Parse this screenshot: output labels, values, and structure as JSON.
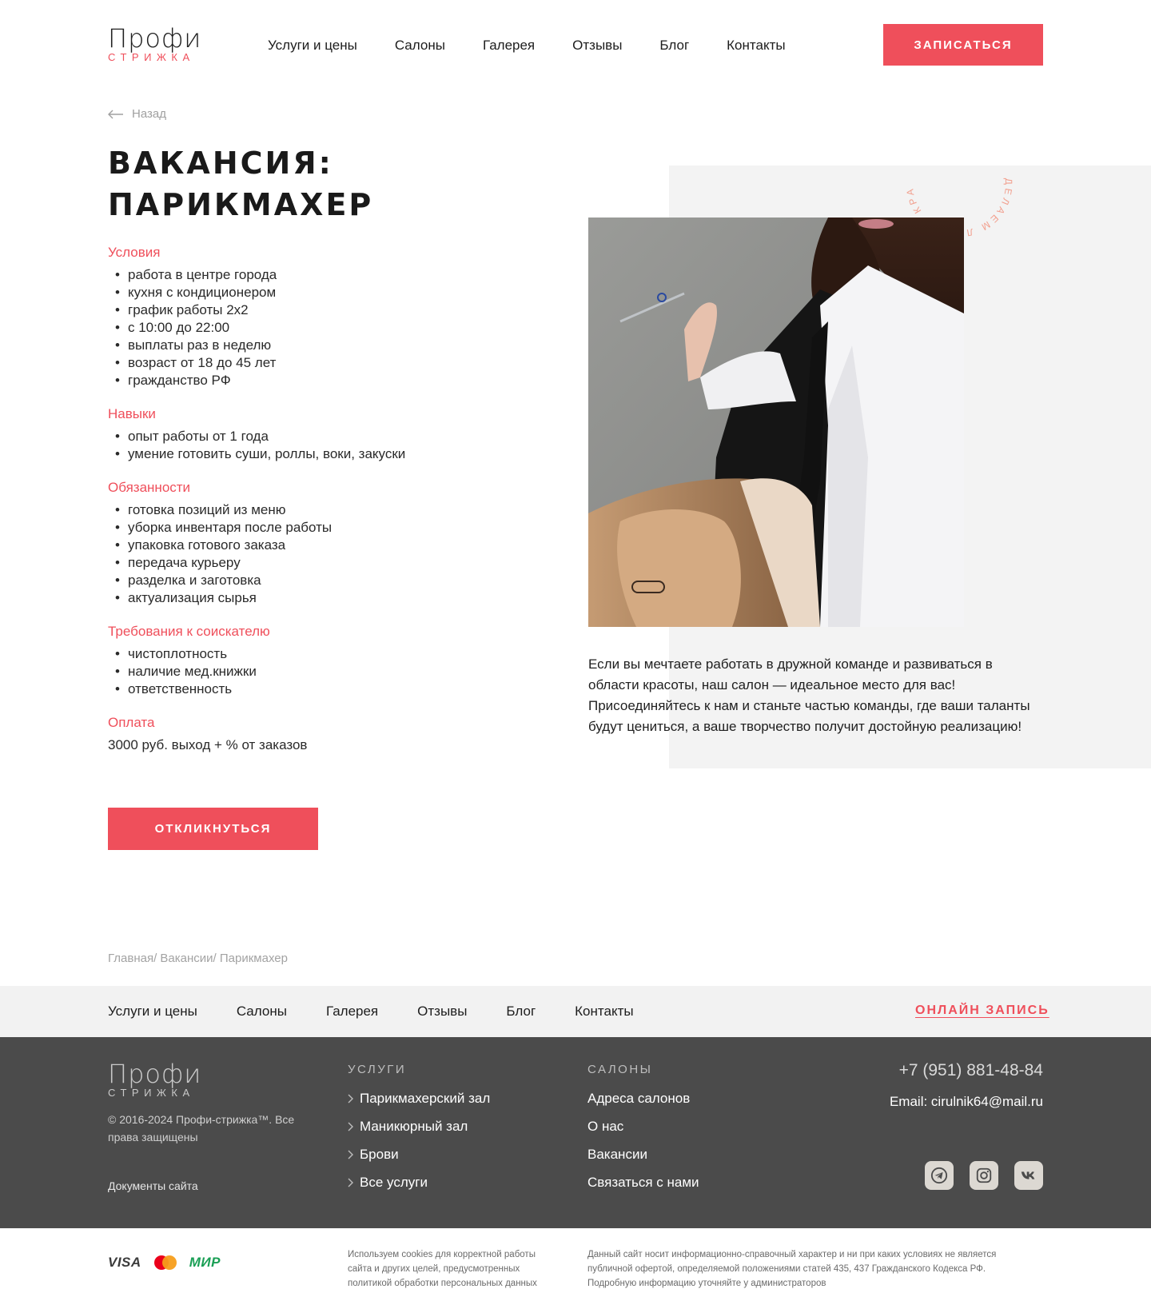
{
  "header": {
    "logo_top": "Профи",
    "logo_bottom": "стрижка",
    "nav": [
      "Услуги и цены",
      "Салоны",
      "Галерея",
      "Отзывы",
      "Блог",
      "Контакты"
    ],
    "signup_button": "Записаться"
  },
  "back_label": "Назад",
  "title_line1": "Вакансия:",
  "title_line2": "парикмахер",
  "sections": {
    "conditions": {
      "heading": "Условия",
      "items": [
        "работа в центре города",
        "кухня с кондиционером",
        "график работы 2х2",
        "с 10:00 до 22:00",
        "выплаты раз в неделю",
        "возраст от 18 до 45 лет",
        "гражданство РФ"
      ]
    },
    "skills": {
      "heading": "Навыки",
      "items": [
        "опыт работы от 1 года",
        "умение готовить суши, роллы, воки, закуски"
      ]
    },
    "duties": {
      "heading": "Обязанности",
      "items": [
        "готовка позиций из меню",
        "уборка инвентаря после работы",
        "упаковка готового заказа",
        "передача курьеру",
        "разделка и заготовка",
        "актуализация сырья"
      ]
    },
    "requirements": {
      "heading": "Требования к соискателю",
      "items": [
        "чистоплотность",
        "наличие мед.книжки",
        "ответственность"
      ]
    },
    "payment": {
      "heading": "Оплата",
      "text": "3000 руб. выход + % от заказов"
    }
  },
  "respond_button": "Откликнуться",
  "badge_text": "делаем людей красивыми в … лет",
  "intro_text": "Если вы мечтаете работать в дружной команде и развиваться в области красоты, наш салон — идеальное место для вас! Присоединяйтесь к нам и станьте частью команды, где ваши таланты будут цениться, а ваше творчество получит достойную реализацию!",
  "breadcrumb": "Главная/ Вакансии/ Парикмахер",
  "footer_nav": [
    "Услуги и цены",
    "Салоны",
    "Галерея",
    "Отзывы",
    "Блог",
    "Контакты"
  ],
  "online_booking": "Онлайн запись",
  "footer": {
    "logo_top": "Профи",
    "logo_bottom": "стрижка",
    "copyright": "© 2016-2024 Профи-стрижка™. Все права защищены",
    "documents": "Документы сайта",
    "services_heading": "Услуги",
    "services": [
      "Парикмахерский зал",
      "Маникюрный зал",
      "Брови",
      "Все услуги"
    ],
    "salons_heading": "Салоны",
    "salons": [
      "Адреса салонов",
      "О нас",
      "Вакансии",
      "Связаться с нами"
    ],
    "phone": "+7 (951) 881-48-84",
    "email": "Email: cirulnik64@mail.ru",
    "socials": [
      "telegram-icon",
      "instagram-icon",
      "vk-icon"
    ]
  },
  "bottom": {
    "pay_visa": "VISA",
    "pay_mir": "МИР",
    "cookies_text": "Используем cookies для корректной работы сайта и других целей, предусмотренных политикой обработки персональных данных",
    "legal_text": "Данный сайт носит информационно-справочный характер и ни при каких условиях не является публичной офертой, определяемой положениями статей 435, 437 Гражданского Кодекса РФ. Подробную информацию уточняйте у администраторов"
  },
  "colors": {
    "accent": "#ef4f5b",
    "footer_bg": "#4b4b4b",
    "panel_bg": "#f3f3f3"
  }
}
